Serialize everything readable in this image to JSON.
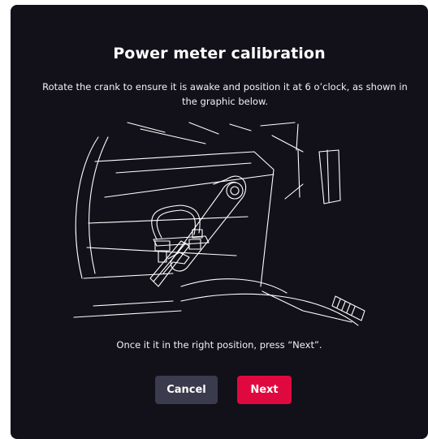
{
  "dialog": {
    "title": "Power meter calibration",
    "instructions": "Rotate the crank to ensure it is awake and position it at 6 o’clock, as shown in the graphic below.",
    "hint": "Once it it in the right position, press “Next”.",
    "cancel_label": "Cancel",
    "next_label": "Next"
  },
  "colors": {
    "background": "#121019",
    "cancel_button": "#3a3b4c",
    "next_button": "#e0093f",
    "line_art": "#ffffff"
  }
}
